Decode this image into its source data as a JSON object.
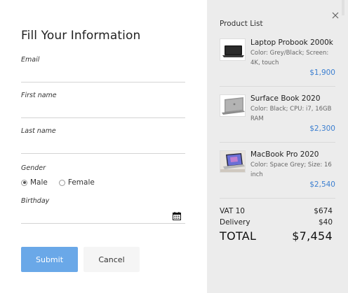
{
  "form": {
    "title": "Fill Your Information",
    "email_label": "Email",
    "first_name_label": "First name",
    "last_name_label": "Last name",
    "gender_label": "Gender",
    "gender_options": [
      "Male",
      "Female"
    ],
    "gender_selected": "Male",
    "birthday_label": "Birthday",
    "submit_label": "Submit",
    "cancel_label": "Cancel",
    "calendar_icon": "calendar-icon"
  },
  "product_list": {
    "title": "Product List",
    "close_icon": "close-icon",
    "items": [
      {
        "name": "Laptop Probook 2000k",
        "desc": "Color: Grey/Black; Screen: 4K, touch",
        "price": "$1,900",
        "thumb_icon": "laptop-thumbnail"
      },
      {
        "name": "Surface Book 2020",
        "desc": "Color: Black; CPU: i7, 16GB RAM",
        "price": "$2,300",
        "thumb_icon": "surface-book-thumbnail"
      },
      {
        "name": "MacBook Pro 2020",
        "desc": "Color: Space Grey; Size: 16 inch",
        "price": "$2,540",
        "thumb_icon": "macbook-thumbnail"
      }
    ],
    "vat_label": "VAT 10",
    "vat_value": "$674",
    "delivery_label": "Delivery",
    "delivery_value": "$40",
    "total_label": "TOTAL",
    "total_value": "$7,454"
  },
  "colors": {
    "submit_bg": "#6aa8e8",
    "price": "#3c7fd0",
    "panel_bg": "#ececec"
  }
}
